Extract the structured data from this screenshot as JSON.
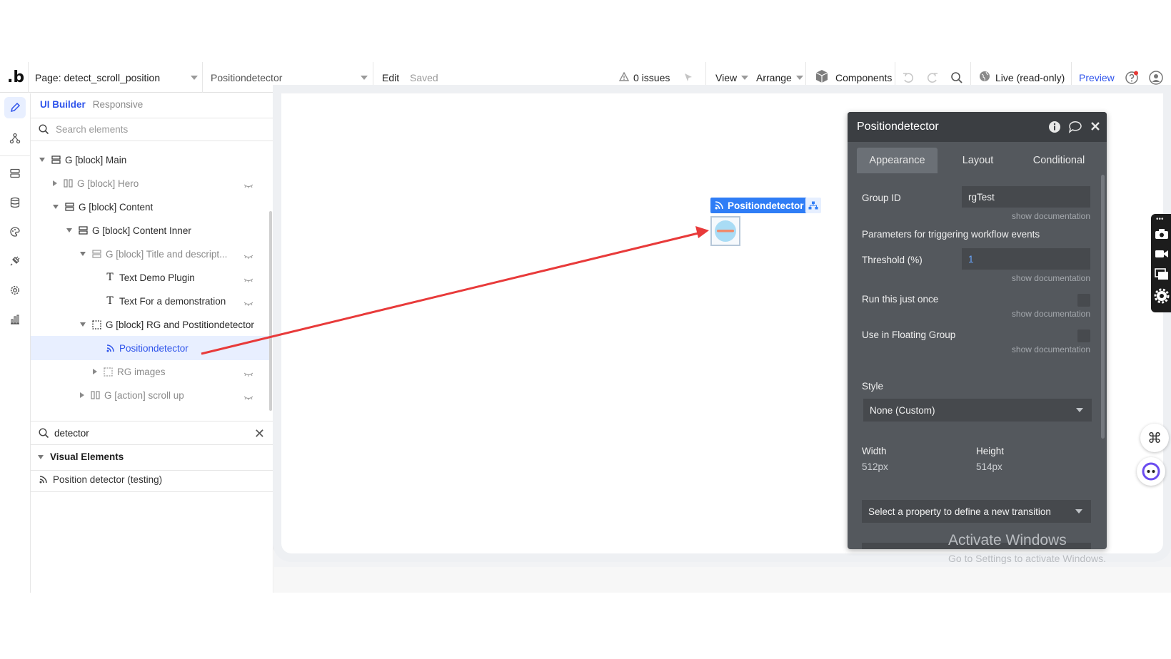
{
  "topbar": {
    "page_label": "Page: detect_scroll_position",
    "element_selector": "Positiondetector",
    "edit": "Edit",
    "saved": "Saved",
    "issues": "0 issues",
    "view": "View",
    "arrange": "Arrange",
    "components": "Components",
    "live": "Live (read-only)",
    "preview": "Preview"
  },
  "left_panel": {
    "tabs": {
      "ui_builder": "UI Builder",
      "responsive": "Responsive"
    },
    "search_placeholder": "Search elements",
    "tree": [
      {
        "label": "G [block] Main"
      },
      {
        "label": "G [block] Hero"
      },
      {
        "label": "G [block] Content"
      },
      {
        "label": "G [block] Content Inner"
      },
      {
        "label": "G [block] Title and descript..."
      },
      {
        "label": "Text Demo Plugin"
      },
      {
        "label": "Text For a demonstration"
      },
      {
        "label": "G [block] RG and Postitiondetector"
      },
      {
        "label": "Positiondetector"
      },
      {
        "label": "RG images"
      },
      {
        "label": "G [action] scroll up"
      }
    ],
    "filter_value": "detector",
    "visual_elements_heading": "Visual Elements",
    "visual_element_item": "Position detector (testing)"
  },
  "canvas": {
    "element_label": "Positiondetector"
  },
  "editor": {
    "title": "Positiondetector",
    "tabs": [
      "Appearance",
      "Layout",
      "Conditional"
    ],
    "group_id_label": "Group ID",
    "group_id_value": "rgTest",
    "show_doc": "show documentation",
    "params_heading": "Parameters for triggering workflow events",
    "threshold_label": "Threshold (%)",
    "threshold_value": "1",
    "run_once_label": "Run this just once",
    "floating_label": "Use in Floating Group",
    "style_label": "Style",
    "style_value": "None (Custom)",
    "width_label": "Width",
    "width_value": "512px",
    "height_label": "Height",
    "height_value": "514px",
    "transition_placeholder": "Select a property to define a new transition"
  },
  "watermark": {
    "line1": "Activate Windows",
    "line2": "Go to Settings to activate Windows."
  },
  "colors": {
    "accent": "#2f54eb",
    "annotation_arrow": "#e83a3a",
    "editor_bg": "#54585d"
  }
}
